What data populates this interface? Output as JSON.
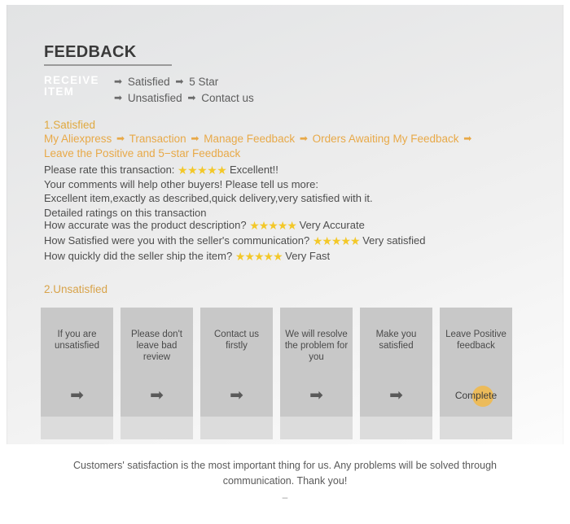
{
  "panel": {
    "title": "FEEDBACK",
    "receive_label": "RECEIVE ITEM",
    "receive_label_line1": "RECEIVE",
    "receive_label_line2": "ITEM",
    "flow": {
      "line1_a": "Satisfied",
      "line1_b": "5 Star",
      "line2_a": "Unsatisfied",
      "line2_b": "Contact us",
      "arrow_icon": "➡"
    }
  },
  "section_satisfied": {
    "title": "1.Satisfied",
    "path": {
      "step1": "My Aliexpress",
      "step2": "Transaction",
      "step3": "Manage Feedback",
      "step4": "Orders Awaiting My Feedback",
      "step5": "Leave the Positive and 5−star Feedback",
      "arrow_icon": "➡"
    },
    "rate_prompt": "Please rate this transaction:",
    "rate_stars": "★★★★★",
    "rate_value": "Excellent!!",
    "comments_prompt": "Your comments will help other buyers! Please tell us more:",
    "comment_text": "Excellent item,exactly as described,quick delivery,very satisfied with it.",
    "detailed_heading": "Detailed ratings on this transaction",
    "ratings": [
      {
        "question": "How accurate was the product description?",
        "stars": "★★★★★",
        "value": "Very Accurate"
      },
      {
        "question": "How Satisfied were you with the seller's communication?",
        "stars": "★★★★★",
        "value": " Very satisfied"
      },
      {
        "question": "How quickly did the seller ship the item?",
        "stars": "★★★★★",
        "value": "Very Fast"
      }
    ]
  },
  "section_unsatisfied": {
    "title": "2.Unsatisfied",
    "arrow_icon": "➡",
    "steps": [
      {
        "label": "If you are unsatisfied",
        "marker": "arrow"
      },
      {
        "label": "Please don't leave bad review",
        "marker": "arrow"
      },
      {
        "label": "Contact us firstly",
        "marker": "arrow"
      },
      {
        "label": "We will resolve the problem for you",
        "marker": "arrow"
      },
      {
        "label": "Make you satisfied",
        "marker": "arrow"
      },
      {
        "label": "Leave Positive feedback",
        "marker": "complete",
        "complete_text": "Complete"
      }
    ]
  },
  "footer": {
    "line1": "Customers' satisfaction is the most important thing for us. Any problems will be solved through",
    "line2": "communication. Thank you!",
    "dash": "–"
  },
  "colors": {
    "accent_orange": "#e8a948",
    "star_gold": "#f3c829",
    "complete_dot": "#f0b84a",
    "body_text": "#4d4d4d",
    "panel_bg": "#ececec",
    "step_top": "#c8c8c8",
    "step_bottom": "#dcdcdc"
  }
}
